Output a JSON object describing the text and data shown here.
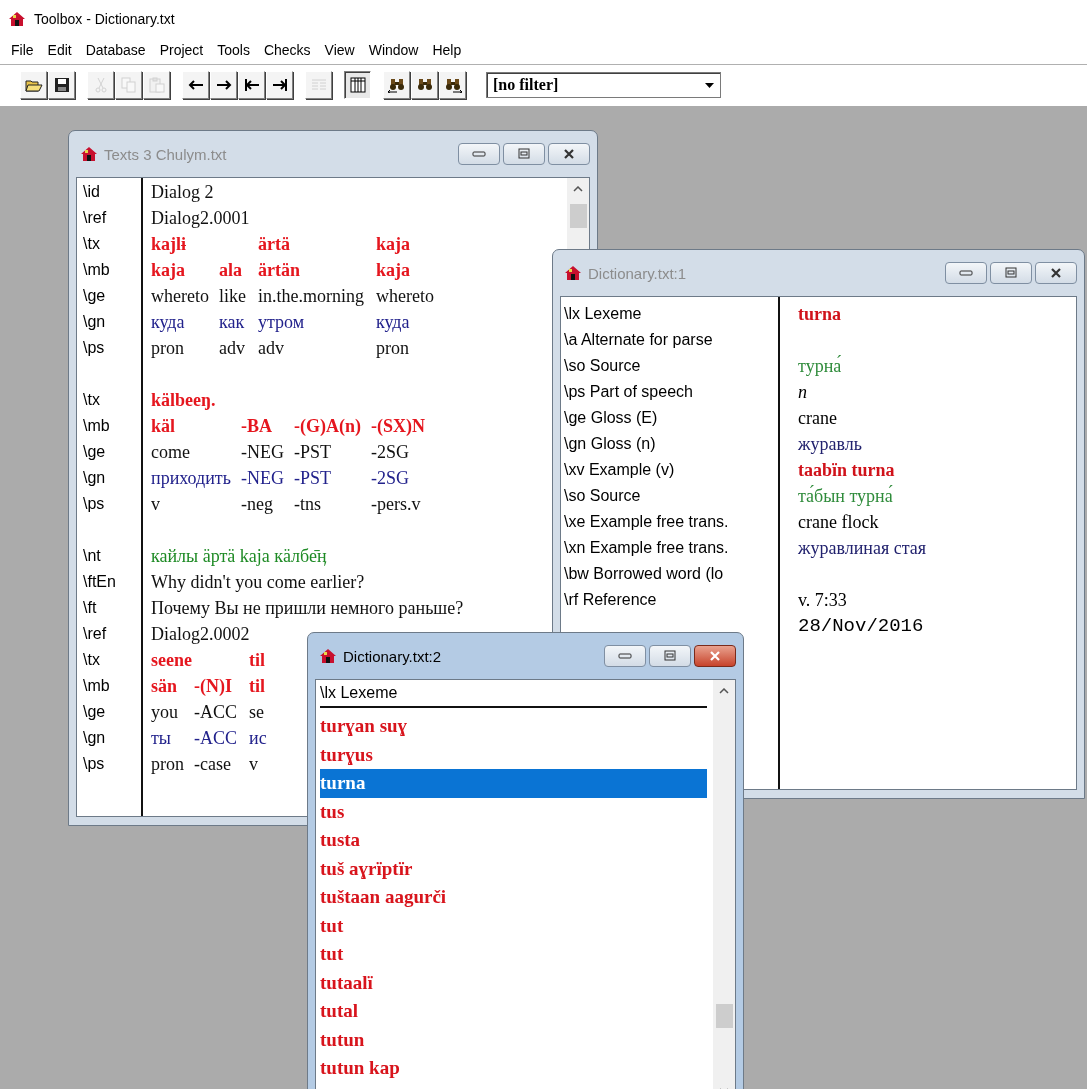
{
  "app": {
    "title": "Toolbox - Dictionary.txt"
  },
  "menu": [
    "File",
    "Edit",
    "Database",
    "Project",
    "Tools",
    "Checks",
    "View",
    "Window",
    "Help"
  ],
  "toolbar": {
    "groups": [
      [
        {
          "kind": "open",
          "disabled": false,
          "pressed": false
        },
        {
          "kind": "save",
          "disabled": false,
          "pressed": false
        }
      ],
      [
        {
          "kind": "cut",
          "disabled": true,
          "pressed": false
        },
        {
          "kind": "copy",
          "disabled": true,
          "pressed": false
        },
        {
          "kind": "paste",
          "disabled": true,
          "pressed": false
        }
      ],
      [
        {
          "kind": "back",
          "disabled": false,
          "pressed": false
        },
        {
          "kind": "forward",
          "disabled": false,
          "pressed": false
        },
        {
          "kind": "first",
          "disabled": false,
          "pressed": false
        },
        {
          "kind": "last",
          "disabled": false,
          "pressed": false
        }
      ],
      [
        {
          "kind": "lines",
          "disabled": true,
          "pressed": false
        }
      ],
      [
        {
          "kind": "browse",
          "disabled": false,
          "pressed": true
        }
      ],
      [
        {
          "kind": "find-prev",
          "disabled": false,
          "pressed": false
        },
        {
          "kind": "find",
          "disabled": false,
          "pressed": false
        },
        {
          "kind": "find-next",
          "disabled": false,
          "pressed": false
        }
      ]
    ],
    "filter": {
      "value": "[no filter]"
    }
  },
  "texts_window": {
    "title": "Texts 3 Chulym.txt",
    "active": false,
    "records": [
      {
        "kind": "field",
        "marker": "\\id",
        "text": "Dialog 2"
      },
      {
        "kind": "field",
        "marker": "\\ref",
        "text": "Dialog2.0001"
      },
      {
        "kind": "interlinear",
        "markers": [
          "\\tx",
          "\\mb",
          "\\ge",
          "\\gn",
          "\\ps"
        ],
        "words": [
          {
            "tx": "kajlɨ",
            "morphemes": [
              {
                "mb": "kaja",
                "ge": "whereto",
                "gn": "куда",
                "ps": "pron"
              },
              {
                "mb": "ala",
                "ge": "like",
                "gn": "как",
                "ps": "adv"
              }
            ]
          },
          {
            "tx": "ärtä",
            "morphemes": [
              {
                "mb": "ärtän",
                "ge": "in.the.morning",
                "gn": "утром",
                "ps": "adv"
              }
            ]
          },
          {
            "tx": "kaja",
            "morphemes": [
              {
                "mb": "kaja",
                "ge": "whereto",
                "gn": "куда",
                "ps": "pron"
              }
            ]
          }
        ]
      },
      {
        "kind": "blank"
      },
      {
        "kind": "interlinear",
        "markers": [
          "\\tx",
          "\\mb",
          "\\ge",
          "\\gn",
          "\\ps"
        ],
        "words": [
          {
            "tx": "kälbeeŋ.",
            "morphemes": [
              {
                "mb": "käl",
                "ge": "come",
                "gn": "приходить",
                "ps": "v"
              },
              {
                "mb": "-BA",
                "ge": "-NEG",
                "gn": "-NEG",
                "ps": "-neg"
              },
              {
                "mb": "-(G)A(n)",
                "ge": "-PST",
                "gn": "-PST",
                "ps": "-tns"
              },
              {
                "mb": "-(SX)N",
                "ge": "-2SG",
                "gn": "-2SG",
                "ps": "-pers.v"
              }
            ]
          }
        ]
      },
      {
        "kind": "blank"
      },
      {
        "kind": "note",
        "marker": "\\nt",
        "text": "кайлы äртä kaja кäлбе̄ӊ"
      },
      {
        "kind": "field",
        "marker": "\\ftEn",
        "text": "Why didn't you come earlier?"
      },
      {
        "kind": "field",
        "marker": "\\ft",
        "text": "Почему Вы не пришли немного раньше?"
      },
      {
        "kind": "field",
        "marker": "\\ref",
        "text": "Dialog2.0002"
      },
      {
        "kind": "interlinear",
        "markers": [
          "\\tx",
          "\\mb",
          "\\ge",
          "\\gn",
          "\\ps"
        ],
        "words": [
          {
            "tx": "seene",
            "morphemes": [
              {
                "mb": "sän",
                "ge": "you",
                "gn": "ты",
                "ps": "pron"
              },
              {
                "mb": "-(N)I",
                "ge": "-ACC",
                "gn": "-ACC",
                "ps": "-case"
              }
            ]
          },
          {
            "tx": "til",
            "morphemes": [
              {
                "mb": "til",
                "ge": "se",
                "gn": "ис",
                "ps": "v"
              }
            ]
          }
        ]
      }
    ]
  },
  "dictionary_entry": {
    "title": "Dictionary.txt:1",
    "active": false,
    "fields": [
      {
        "label": "\\lx  Lexeme",
        "kind": "vernacular",
        "value": "turna"
      },
      {
        "label": "\\a  Alternate for parse"
      },
      {
        "label": "\\so  Source",
        "kind": "source",
        "value": "турна́"
      },
      {
        "label": "\\ps  Part of speech",
        "kind": "pos",
        "value": "n"
      },
      {
        "label": "\\ge  Gloss (E)",
        "kind": "gloss",
        "value": "crane"
      },
      {
        "label": "\\gn  Gloss (n)",
        "kind": "national",
        "value": "журавль"
      },
      {
        "label": "\\xv  Example (v)",
        "kind": "vernacular",
        "value": "taabïn turna"
      },
      {
        "label": "\\so  Source",
        "kind": "source",
        "value": "та́бын турна́"
      },
      {
        "label": "\\xe  Example free trans.",
        "kind": "gloss",
        "value": "crane flock"
      },
      {
        "label": "\\xn  Example free trans.",
        "kind": "national",
        "value": "журавлиная стая"
      },
      {
        "label": "\\bw  Borrowed word (lo"
      },
      {
        "label": "\\rf  Reference",
        "kind": "gloss",
        "value": "v. 7:33"
      },
      {
        "kind": "date",
        "value": "28/Nov/2016"
      }
    ]
  },
  "dictionary_list": {
    "title": "Dictionary.txt:2",
    "active": true,
    "header": "\\lx  Lexeme",
    "items": [
      {
        "text": "turɣan suɣ",
        "selected": false
      },
      {
        "text": "turɣus",
        "selected": false
      },
      {
        "text": "turna",
        "selected": true
      },
      {
        "text": "tus",
        "selected": false
      },
      {
        "text": "tusta",
        "selected": false
      },
      {
        "text": "tuš aɣrïptïr",
        "selected": false
      },
      {
        "text": "tuštaan aagurči",
        "selected": false
      },
      {
        "text": "tut",
        "selected": false
      },
      {
        "text": "tut",
        "selected": false
      },
      {
        "text": "tutaalï",
        "selected": false
      },
      {
        "text": "tutal",
        "selected": false
      },
      {
        "text": "tutun",
        "selected": false
      },
      {
        "text": "tutun kap",
        "selected": false
      }
    ]
  }
}
